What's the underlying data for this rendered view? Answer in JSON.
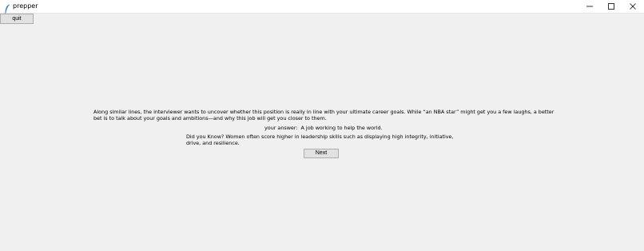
{
  "window": {
    "title": "prepper",
    "controls": {
      "minimize_icon": "minimize-icon",
      "maximize_icon": "maximize-icon",
      "close_icon": "close-icon"
    }
  },
  "toolbar": {
    "quit_label": "quit"
  },
  "main": {
    "question": "Along similar lines, the interviewer wants to uncover whether this position is really in line with your ultimate career goals. While “an NBA star” might get you a few laughs, a better bet is to talk about your goals and ambitions—and why this job will get you closer to them.",
    "answer_label": "your answer:",
    "answer_value": "A job working to help the world.",
    "tip": "Did you Know? Women often score higher in leadership skills such as displaying high integrity, initiative, drive, and resilience.",
    "next_label": "Next"
  },
  "colors": {
    "background": "#f0f0f0",
    "titlebar": "#ffffff",
    "button": "#e1e1e1",
    "button_border": "#adadad"
  }
}
